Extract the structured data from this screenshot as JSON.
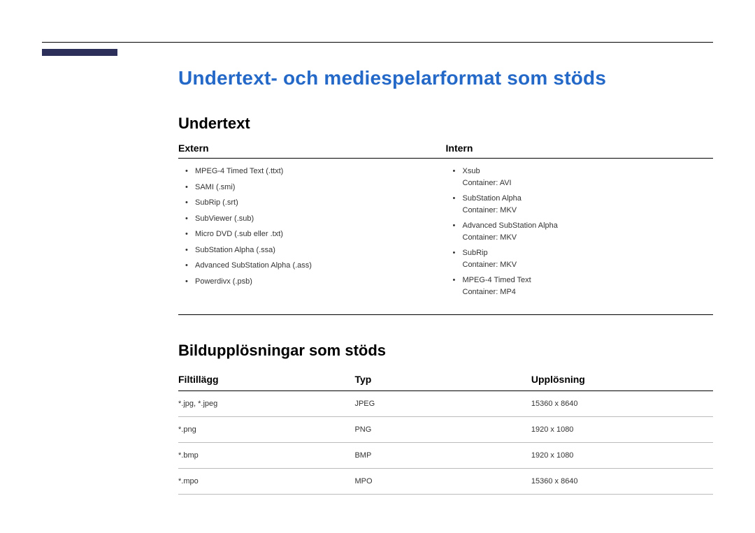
{
  "title": "Undertext- och mediespelarformat som stöds",
  "sections": {
    "subtitle": {
      "heading": "Undertext",
      "extern": {
        "label": "Extern",
        "items": [
          {
            "text": "MPEG-4 Timed Text (.ttxt)"
          },
          {
            "text": "SAMI (.smi)"
          },
          {
            "text": "SubRip (.srt)"
          },
          {
            "text": "SubViewer (.sub)"
          },
          {
            "text": "Micro DVD (.sub eller .txt)"
          },
          {
            "text": "SubStation Alpha (.ssa)"
          },
          {
            "text": "Advanced SubStation Alpha (.ass)"
          },
          {
            "text": "Powerdivx (.psb)"
          }
        ]
      },
      "intern": {
        "label": "Intern",
        "items": [
          {
            "text": "Xsub",
            "sub": "Container: AVI"
          },
          {
            "text": "SubStation Alpha",
            "sub": "Container: MKV"
          },
          {
            "text": "Advanced SubStation Alpha",
            "sub": "Container: MKV"
          },
          {
            "text": "SubRip",
            "sub": "Container: MKV"
          },
          {
            "text": "MPEG-4 Timed Text",
            "sub": "Container: MP4"
          }
        ]
      }
    },
    "resolutions": {
      "heading": "Bildupplösningar som stöds",
      "headers": {
        "ext": "Filtillägg",
        "type": "Typ",
        "res": "Upplösning"
      },
      "rows": [
        {
          "ext": "*.jpg, *.jpeg",
          "type": "JPEG",
          "res": "15360 x 8640"
        },
        {
          "ext": "*.png",
          "type": "PNG",
          "res": "1920 x 1080"
        },
        {
          "ext": "*.bmp",
          "type": "BMP",
          "res": "1920 x 1080"
        },
        {
          "ext": "*.mpo",
          "type": "MPO",
          "res": "15360 x 8640"
        }
      ]
    }
  }
}
